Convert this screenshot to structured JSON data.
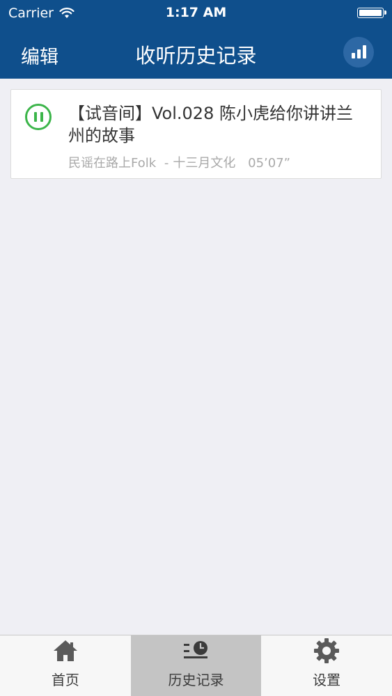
{
  "status_bar": {
    "carrier": "Carrier",
    "time": "1:17 AM"
  },
  "nav": {
    "edit_label": "编辑",
    "title": "收听历史记录",
    "stats_icon": "bar-chart-icon",
    "background_color": "#0f4f8c"
  },
  "history": [
    {
      "title": "【试音间】Vol.028 陈小虎给你讲讲兰州的故事",
      "channel": "民谣在路上Folk",
      "separator": "-",
      "publisher": "十三月文化",
      "duration": "05’07”",
      "state_icon": "pause-icon",
      "accent_color": "#3cb54a"
    }
  ],
  "tabs": [
    {
      "label": "首页",
      "icon": "home-icon",
      "active": false
    },
    {
      "label": "历史记录",
      "icon": "history-icon",
      "active": true
    },
    {
      "label": "设置",
      "icon": "gear-icon",
      "active": false
    }
  ]
}
